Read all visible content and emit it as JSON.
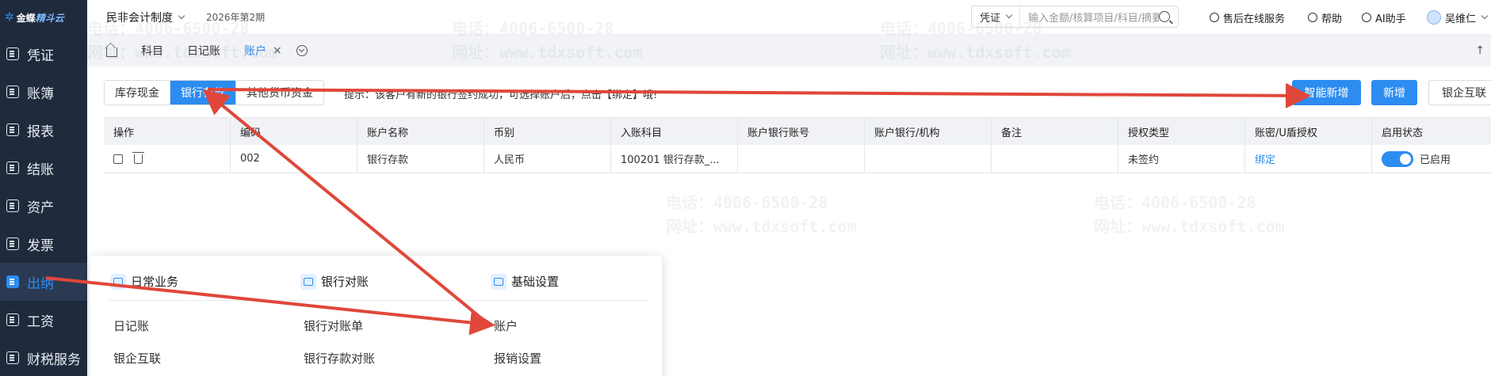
{
  "sidebar": {
    "logo_text": "金蝶",
    "logo_sub": "精斗云",
    "items": [
      {
        "label": "凭证",
        "icon": "voucher-icon"
      },
      {
        "label": "账簿",
        "icon": "ledger-icon"
      },
      {
        "label": "报表",
        "icon": "report-icon"
      },
      {
        "label": "结账",
        "icon": "closing-icon"
      },
      {
        "label": "资产",
        "icon": "asset-icon"
      },
      {
        "label": "发票",
        "icon": "invoice-icon"
      },
      {
        "label": "出纳",
        "icon": "cashier-icon",
        "active": true
      },
      {
        "label": "工资",
        "icon": "salary-icon"
      },
      {
        "label": "财税服务",
        "icon": "tax-service-icon"
      }
    ]
  },
  "topbar": {
    "org": "民非会计制度",
    "period": "2026年第2期",
    "search_type": "凭证",
    "search_placeholder": "输入金额/核算项目/科目/摘要",
    "service": "售后在线服务",
    "help": "帮助",
    "ai": "AI助手",
    "user": "吴维仁"
  },
  "tabs": [
    {
      "label": "科目"
    },
    {
      "label": "日记账"
    },
    {
      "label": "账户",
      "active": true,
      "close": "×"
    }
  ],
  "account_tabs": [
    "库存现金",
    "银行存款",
    "其他货币资金"
  ],
  "hint": "提示：该客户有新的银行签约成功，可选择账户后，点击【绑定】哦!",
  "buttons": {
    "smart_add": "智能新增",
    "add": "新增",
    "bank_link": "银企互联"
  },
  "table": {
    "columns": [
      "操作",
      "编码",
      "账户名称",
      "币别",
      "入账科目",
      "账户银行账号",
      "账户银行/机构",
      "备注",
      "授权类型",
      "账密/U盾授权",
      "启用状态"
    ],
    "rows": [
      {
        "code": "002",
        "name": "银行存款",
        "currency": "人民币",
        "subject": "100201 银行存款_...",
        "account_no": "",
        "bank": "",
        "note": "",
        "auth_type": "未签约",
        "auth_action": "绑定",
        "status": "已启用"
      }
    ]
  },
  "menu_panel": {
    "sections": [
      {
        "title": "日常业务",
        "items": [
          "日记账",
          "银企互联"
        ]
      },
      {
        "title": "银行对账",
        "items": [
          "银行对账单",
          "银行存款对账"
        ]
      },
      {
        "title": "基础设置",
        "items": [
          "账户",
          "报销设置"
        ]
      }
    ]
  },
  "watermark": {
    "phone": "电话：4006-6500-28",
    "site": "网址：www.tdxsoft.com"
  },
  "colors": {
    "accent": "#2d8cf0",
    "sidebar_bg": "#1f2b3d",
    "annotation_arrow": "#e0473a"
  }
}
